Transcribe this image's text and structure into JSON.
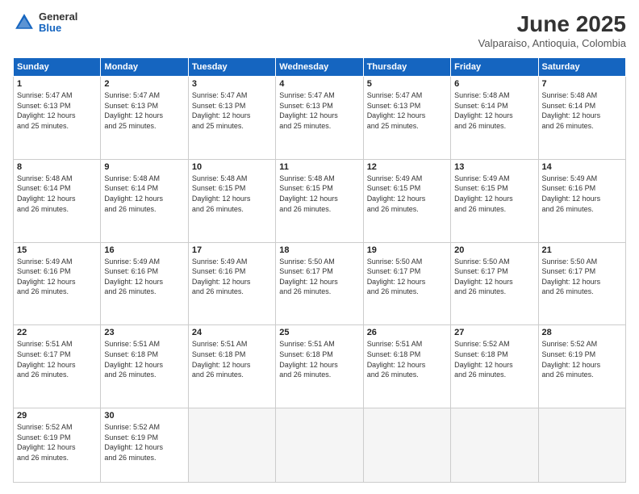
{
  "logo": {
    "line1": "General",
    "line2": "Blue"
  },
  "title": "June 2025",
  "subtitle": "Valparaiso, Antioquia, Colombia",
  "headers": [
    "Sunday",
    "Monday",
    "Tuesday",
    "Wednesday",
    "Thursday",
    "Friday",
    "Saturday"
  ],
  "weeks": [
    [
      {
        "day": "1",
        "info": "Sunrise: 5:47 AM\nSunset: 6:13 PM\nDaylight: 12 hours\nand 25 minutes."
      },
      {
        "day": "2",
        "info": "Sunrise: 5:47 AM\nSunset: 6:13 PM\nDaylight: 12 hours\nand 25 minutes."
      },
      {
        "day": "3",
        "info": "Sunrise: 5:47 AM\nSunset: 6:13 PM\nDaylight: 12 hours\nand 25 minutes."
      },
      {
        "day": "4",
        "info": "Sunrise: 5:47 AM\nSunset: 6:13 PM\nDaylight: 12 hours\nand 25 minutes."
      },
      {
        "day": "5",
        "info": "Sunrise: 5:47 AM\nSunset: 6:13 PM\nDaylight: 12 hours\nand 25 minutes."
      },
      {
        "day": "6",
        "info": "Sunrise: 5:48 AM\nSunset: 6:14 PM\nDaylight: 12 hours\nand 26 minutes."
      },
      {
        "day": "7",
        "info": "Sunrise: 5:48 AM\nSunset: 6:14 PM\nDaylight: 12 hours\nand 26 minutes."
      }
    ],
    [
      {
        "day": "8",
        "info": "Sunrise: 5:48 AM\nSunset: 6:14 PM\nDaylight: 12 hours\nand 26 minutes."
      },
      {
        "day": "9",
        "info": "Sunrise: 5:48 AM\nSunset: 6:14 PM\nDaylight: 12 hours\nand 26 minutes."
      },
      {
        "day": "10",
        "info": "Sunrise: 5:48 AM\nSunset: 6:15 PM\nDaylight: 12 hours\nand 26 minutes."
      },
      {
        "day": "11",
        "info": "Sunrise: 5:48 AM\nSunset: 6:15 PM\nDaylight: 12 hours\nand 26 minutes."
      },
      {
        "day": "12",
        "info": "Sunrise: 5:49 AM\nSunset: 6:15 PM\nDaylight: 12 hours\nand 26 minutes."
      },
      {
        "day": "13",
        "info": "Sunrise: 5:49 AM\nSunset: 6:15 PM\nDaylight: 12 hours\nand 26 minutes."
      },
      {
        "day": "14",
        "info": "Sunrise: 5:49 AM\nSunset: 6:16 PM\nDaylight: 12 hours\nand 26 minutes."
      }
    ],
    [
      {
        "day": "15",
        "info": "Sunrise: 5:49 AM\nSunset: 6:16 PM\nDaylight: 12 hours\nand 26 minutes."
      },
      {
        "day": "16",
        "info": "Sunrise: 5:49 AM\nSunset: 6:16 PM\nDaylight: 12 hours\nand 26 minutes."
      },
      {
        "day": "17",
        "info": "Sunrise: 5:49 AM\nSunset: 6:16 PM\nDaylight: 12 hours\nand 26 minutes."
      },
      {
        "day": "18",
        "info": "Sunrise: 5:50 AM\nSunset: 6:17 PM\nDaylight: 12 hours\nand 26 minutes."
      },
      {
        "day": "19",
        "info": "Sunrise: 5:50 AM\nSunset: 6:17 PM\nDaylight: 12 hours\nand 26 minutes."
      },
      {
        "day": "20",
        "info": "Sunrise: 5:50 AM\nSunset: 6:17 PM\nDaylight: 12 hours\nand 26 minutes."
      },
      {
        "day": "21",
        "info": "Sunrise: 5:50 AM\nSunset: 6:17 PM\nDaylight: 12 hours\nand 26 minutes."
      }
    ],
    [
      {
        "day": "22",
        "info": "Sunrise: 5:51 AM\nSunset: 6:17 PM\nDaylight: 12 hours\nand 26 minutes."
      },
      {
        "day": "23",
        "info": "Sunrise: 5:51 AM\nSunset: 6:18 PM\nDaylight: 12 hours\nand 26 minutes."
      },
      {
        "day": "24",
        "info": "Sunrise: 5:51 AM\nSunset: 6:18 PM\nDaylight: 12 hours\nand 26 minutes."
      },
      {
        "day": "25",
        "info": "Sunrise: 5:51 AM\nSunset: 6:18 PM\nDaylight: 12 hours\nand 26 minutes."
      },
      {
        "day": "26",
        "info": "Sunrise: 5:51 AM\nSunset: 6:18 PM\nDaylight: 12 hours\nand 26 minutes."
      },
      {
        "day": "27",
        "info": "Sunrise: 5:52 AM\nSunset: 6:18 PM\nDaylight: 12 hours\nand 26 minutes."
      },
      {
        "day": "28",
        "info": "Sunrise: 5:52 AM\nSunset: 6:19 PM\nDaylight: 12 hours\nand 26 minutes."
      }
    ],
    [
      {
        "day": "29",
        "info": "Sunrise: 5:52 AM\nSunset: 6:19 PM\nDaylight: 12 hours\nand 26 minutes."
      },
      {
        "day": "30",
        "info": "Sunrise: 5:52 AM\nSunset: 6:19 PM\nDaylight: 12 hours\nand 26 minutes."
      },
      {
        "day": "",
        "info": ""
      },
      {
        "day": "",
        "info": ""
      },
      {
        "day": "",
        "info": ""
      },
      {
        "day": "",
        "info": ""
      },
      {
        "day": "",
        "info": ""
      }
    ]
  ]
}
